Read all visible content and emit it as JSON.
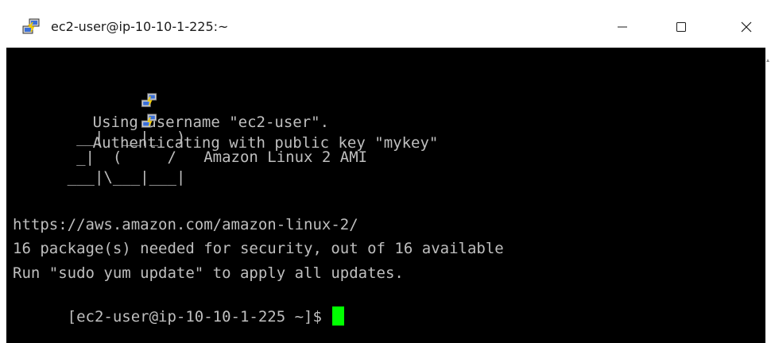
{
  "window": {
    "title": "ec2-user@ip-10-10-1-225:~",
    "icon": "putty-icon",
    "controls": {
      "minimize_glyph": "—",
      "maximize_glyph": "☐",
      "close_glyph": "✕"
    }
  },
  "terminal": {
    "background": "#000000",
    "text_color": "#bfbfbf",
    "cursor_color": "#00ff00",
    "lines": [
      "Using username \"ec2-user\".",
      "Authenticating with public key \"mykey\"",
      "",
      "       __|  __|_  )",
      "       _|  (     /   Amazon Linux 2 AMI",
      "      ___|\\___|___|",
      "",
      "https://aws.amazon.com/amazon-linux-2/",
      "16 package(s) needed for security, out of 16 available",
      "Run \"sudo yum update\" to apply all updates.",
      "[ec2-user@ip-10-10-1-225 ~]$ "
    ]
  }
}
